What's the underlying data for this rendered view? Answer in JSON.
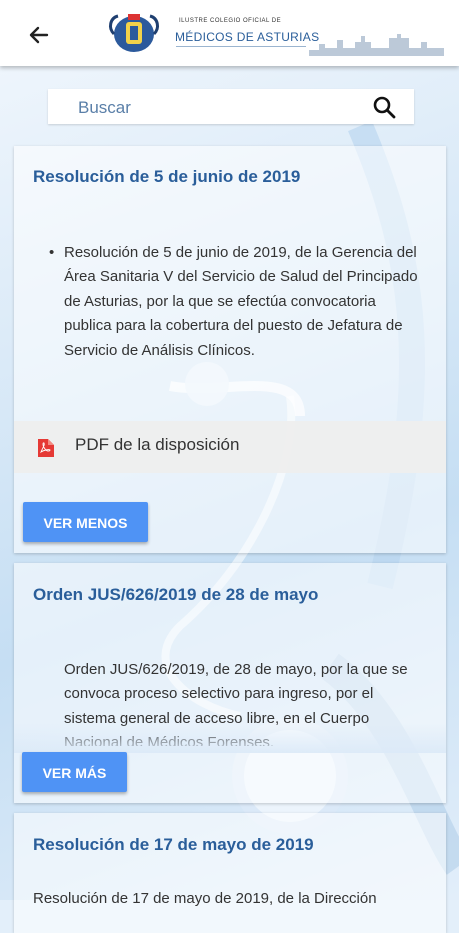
{
  "header": {
    "back_icon": "arrow-left-icon",
    "logo": {
      "small_text": "ILUSTRE COLEGIO OFICIAL DE",
      "big_text": "MÉDICOS DE ASTURIAS"
    }
  },
  "search": {
    "placeholder": "Buscar",
    "icon": "search-icon"
  },
  "cards": [
    {
      "title": "Resolución de 5 de junio de 2019",
      "body": "Resolución de 5 de junio de 2019, de la Gerencia del Área Sanitaria V del Servicio de Salud del Principado de Asturias, por la que se efectúa convocatoria publica para la cobertura del puesto de Jefatura de Servicio de Análisis Clínicos.",
      "attachment_label": "PDF de la disposición",
      "attachment_icon": "pdf-icon",
      "button_label": "VER MENOS"
    },
    {
      "title": "Orden JUS/626/2019 de 28 de mayo",
      "body": "Orden JUS/626/2019, de 28 de mayo, por la que se convoca proceso selectivo para ingreso, por el sistema general de acceso libre, en el Cuerpo Nacional de Médicos Forenses.",
      "button_label": "VER MÁS"
    },
    {
      "title": "Resolución de 17 de mayo de 2019",
      "body": "Resolución de 17 de mayo de 2019, de la Dirección"
    }
  ],
  "colors": {
    "accent": "#2a5e9a",
    "button": "#4f93f5"
  }
}
